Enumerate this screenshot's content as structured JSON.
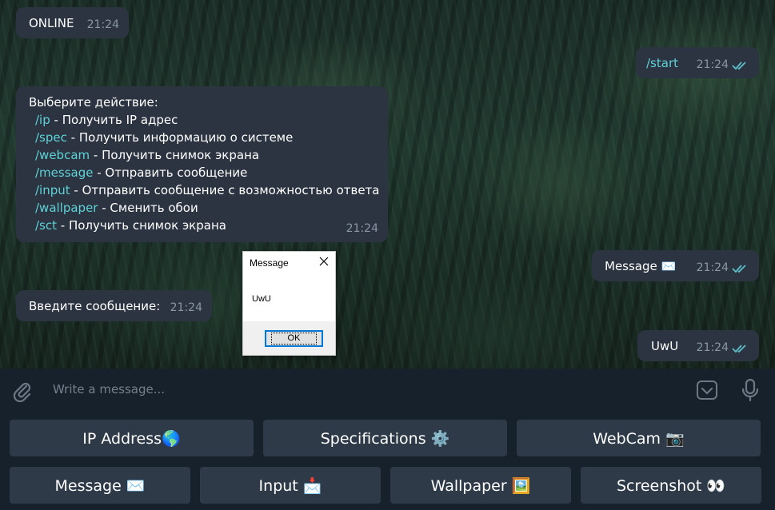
{
  "messages": {
    "online": {
      "text": "ONLINE",
      "time": "21:24"
    },
    "start": {
      "text": "/start",
      "time": "21:24"
    },
    "menu": {
      "heading": "Выберите действие:",
      "items": [
        {
          "cmd": "/ip",
          "desc": " - Получить IP адрес"
        },
        {
          "cmd": "/spec",
          "desc": " - Получить информацию о системе"
        },
        {
          "cmd": "/webcam",
          "desc": " - Получить снимок экрана"
        },
        {
          "cmd": "/message",
          "desc": " - Отправить сообщение"
        },
        {
          "cmd": "/input",
          "desc": " - Отправить сообщение с возможностью ответа"
        },
        {
          "cmd": "/wallpaper",
          "desc": " - Сменить обои"
        },
        {
          "cmd": "/sct",
          "desc": " - Получить снимок экрана"
        }
      ],
      "time": "21:24"
    },
    "message_out": {
      "text": "Message ✉️",
      "time": "21:24"
    },
    "prompt": {
      "text": "Введите сообщение:",
      "time": "21:24"
    },
    "uwu_out": {
      "text": "UwU",
      "time": "21:24"
    }
  },
  "dialog": {
    "title": "Message",
    "body": "UwU",
    "ok_label": "OK"
  },
  "composer": {
    "placeholder": "Write a message..."
  },
  "keyboard": {
    "row1": [
      "IP Address🌎",
      "Specifications ⚙️",
      "WebCam 📷"
    ],
    "row2": [
      "Message ✉️",
      "Input 📩",
      "Wallpaper 🖼️",
      "Screenshot 👀"
    ]
  },
  "colors": {
    "command": "#5fd3d8",
    "check": "#5fbfc9",
    "bubble": "#2b3440",
    "key": "#2e3a48"
  }
}
